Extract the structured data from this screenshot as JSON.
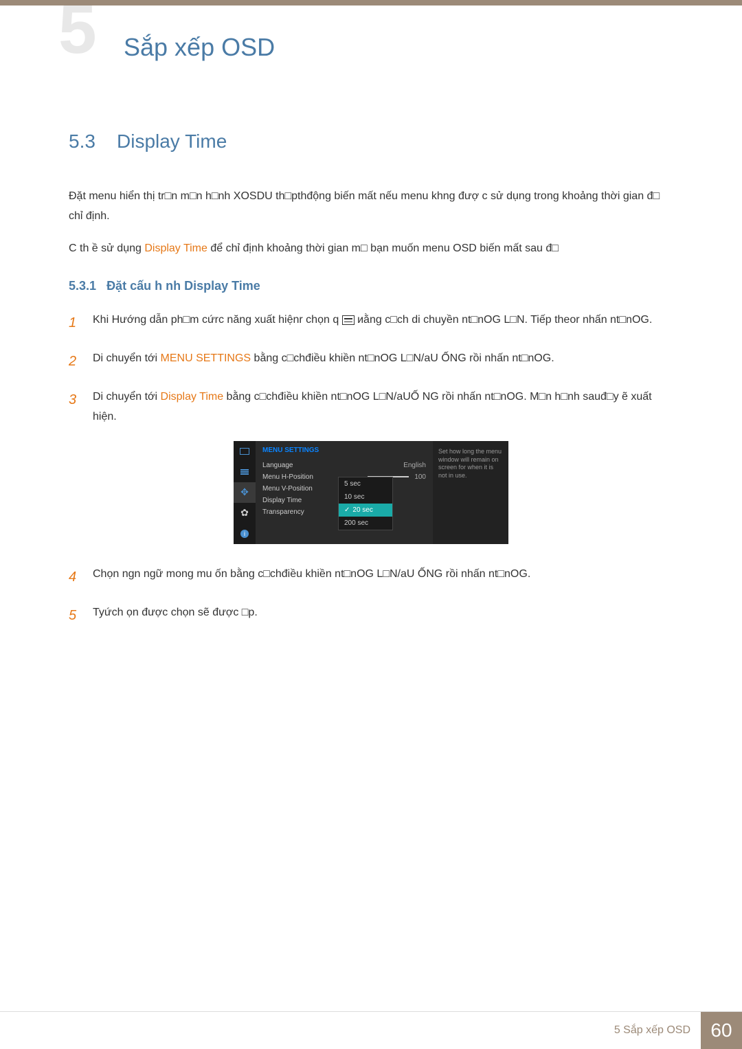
{
  "chapter": {
    "number": "5",
    "title": "Sắp xếp OSD"
  },
  "section": {
    "number": "5.3",
    "title": "Display Time",
    "paragraphs": [
      "Đặt menu hiển thị tr□n m□n h□nh XOSDU th□pthđộng biến mất nếu menu khng đượ  c sử dụng trong khoảng thời gian đ□ chỉ định.",
      "C th ề sử dụng "
    ],
    "display_time_text": "Display Time",
    "para2_suffix": "  để chỉ định khoảng thời gian m□ bạn muốn menu OSD biến mất sau đ□"
  },
  "subsection": {
    "number": "5.3.1",
    "title": "Đặt cấu h nh Display Time"
  },
  "steps": [
    {
      "num": "1",
      "text_before": "Khi Hướng dẫn ph□m cứrc năng xuất hiệnr chọn q ",
      "text_after": "  иằng c□ch di chuyền nt□nOG L□N. Tiếp theor nhấn nt□nOG."
    },
    {
      "num": "2",
      "text_before": "Di chuyển tới ",
      "orange": "MENU SETTINGS",
      "text_after": " bằng c□chđiều khiền nt□nOG L□N/aU  ỐNG rồi nhấn nt□nOG."
    },
    {
      "num": "3",
      "text_before": "Di chuyển tới ",
      "orange": "Display Time",
      "text_after": "  bằng c□chđiều khiền nt□nOG L□N/aUỐ  NG rồi nhấn nt□nOG. M□n h□nh sauđ□y ẽ xuất hiện."
    },
    {
      "num": "4",
      "text": "Chọn ngn ngữ mong mu  ốn bằng c□chđiều khiền nt□nOG L□N/aU  ỐNG rồi nhấn nt□nOG."
    },
    {
      "num": "5",
      "text": "Tyứch  ọn được chọn sẽ được □p."
    }
  ],
  "osd": {
    "menu_title": "MENU SETTINGS",
    "rows": [
      {
        "label": "Language",
        "value": "English"
      },
      {
        "label": "Menu H-Position",
        "value": "100"
      },
      {
        "label": "Menu V-Position",
        "value": ""
      },
      {
        "label": "Display Time",
        "value": ""
      },
      {
        "label": "Transparency",
        "value": ""
      }
    ],
    "options": [
      {
        "label": "5 sec",
        "selected": false
      },
      {
        "label": "10 sec",
        "selected": false
      },
      {
        "label": "20 sec",
        "selected": true
      },
      {
        "label": "200 sec",
        "selected": false
      }
    ],
    "help_text": "Set how long the menu window will remain on screen for when it is not in use."
  },
  "footer": {
    "text": "5 Sắp xếp OSD",
    "page": "60"
  }
}
